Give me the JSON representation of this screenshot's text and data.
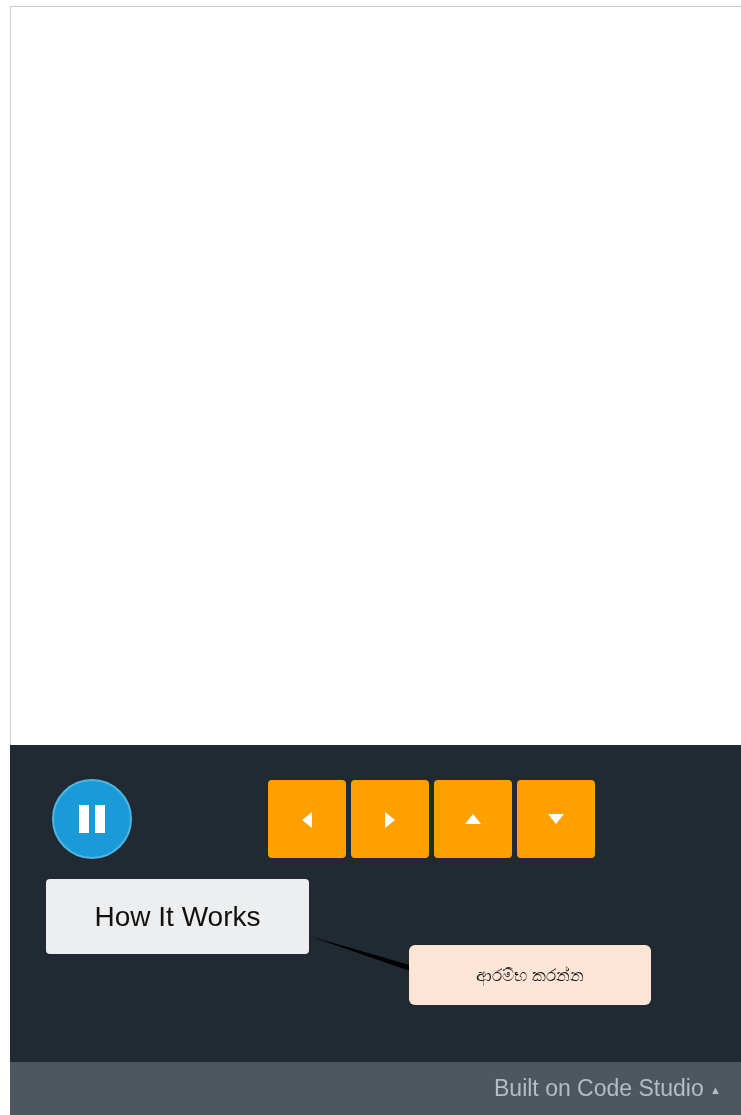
{
  "control_panel": {
    "run_button": {
      "kind": "pause"
    },
    "arrow_buttons": [
      {
        "kind": "left"
      },
      {
        "kind": "right"
      },
      {
        "kind": "up"
      },
      {
        "kind": "down"
      }
    ],
    "how_it_works_button": "How It Works",
    "callout": "ආරම්භ කරන්න"
  },
  "footer": {
    "label": "Built on Code Studio",
    "caret": "▲"
  }
}
